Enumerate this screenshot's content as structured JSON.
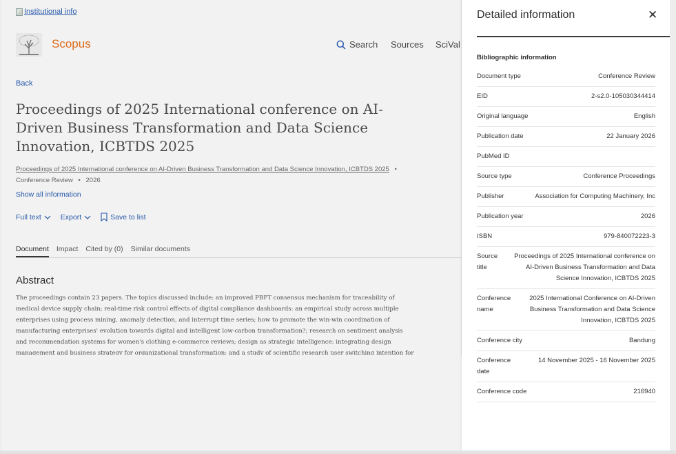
{
  "institution_link": "Institutional info",
  "brand": {
    "name": "Scopus"
  },
  "nav": {
    "search": "Search",
    "sources": "Sources",
    "scival": "SciVal"
  },
  "back": "Back",
  "title": "Proceedings of 2025 International conference on AI-Driven Business Transformation and Data Science Innovation, ICBTDS 2025",
  "meta": {
    "source": "Proceedings of 2025 International conference on AI-Driven Business Transformation and Data Science Innovation, ICBTDS 2025",
    "doc_type": "Conference Review",
    "year": "2026"
  },
  "show_all": "Show all information",
  "actions": {
    "full_text": "Full text",
    "export": "Export",
    "save": "Save to list"
  },
  "tabs": [
    "Document",
    "Impact",
    "Cited by (0)",
    "Similar documents"
  ],
  "abstract": {
    "heading": "Abstract",
    "text": "The proceedings contain 23 papers. The topics discussed include: an improved PBFT consensus mechanism for traceability of medical device supply chain; real-time risk control effects of digital compliance dashboards: an empirical study across multiple enterprises using process mining, anomaly detection, and interrupt time series; how to promote the win-win coordination of manufacturing enterprises' evolution towards digital and intelligent low-carbon transformation?; research on sentiment analysis and recommendation systems for women's clothing e-commerce reviews; design as strategic intelligence: integrating design management and business strategy for organizational transformation; and a study of scientific research user switching intention for"
  },
  "panel": {
    "title": "Detailed information",
    "section": "Bibliographic information",
    "rows": [
      {
        "key": "Document type",
        "value": "Conference Review"
      },
      {
        "key": "EID",
        "value": "2-s2.0-105030344414"
      },
      {
        "key": "Original language",
        "value": "English"
      },
      {
        "key": "Publication date",
        "value": "22 January 2026"
      },
      {
        "key": "PubMed ID",
        "value": ""
      },
      {
        "key": "Source type",
        "value": "Conference Proceedings"
      },
      {
        "key": "Publisher",
        "value": "Association for Computing Machinery, Inc"
      },
      {
        "key": "Publication year",
        "value": "2026"
      },
      {
        "key": "ISBN",
        "value": "979-840072223-3"
      },
      {
        "key": "Source title",
        "value": "Proceedings of 2025 International conference on AI-Driven Business Transformation and Data Science Innovation, ICBTDS 2025"
      },
      {
        "key": "Conference name",
        "value": "2025 International Conference on AI-Driven Business Transformation and Data Science Innovation, ICBTDS 2025"
      },
      {
        "key": "Conference city",
        "value": "Bandung"
      },
      {
        "key": "Conference date",
        "value": "14 November 2025 - 16 November 2025"
      },
      {
        "key": "Conference code",
        "value": "216940"
      }
    ]
  },
  "icons": [
    "broken-image-icon",
    "elsevier-tree-logo",
    "search-icon",
    "chevron-down-icon",
    "bookmark-icon",
    "close-icon"
  ],
  "colors": {
    "brand": "#e9711c",
    "link": "#2b5fb4"
  }
}
